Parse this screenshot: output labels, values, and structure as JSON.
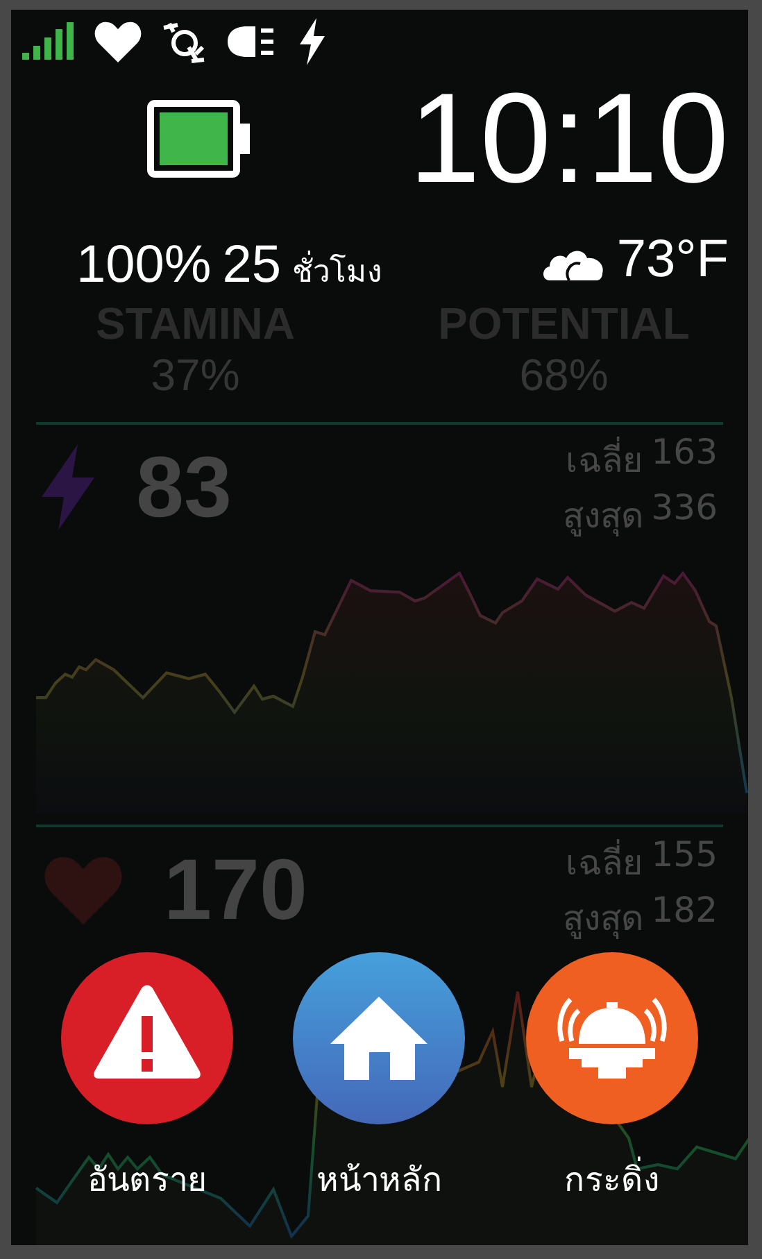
{
  "device_status": {
    "clock": "10:10",
    "battery_percent": "100%",
    "runtime": "25",
    "runtime_unit": "ชั่วโมง",
    "temperature": "73°F"
  },
  "metrics_header": [
    {
      "label": "STAMINA",
      "value": "37%"
    },
    {
      "label": "POTENTIAL",
      "value": "68%"
    }
  ],
  "fields": [
    {
      "kind": "power",
      "value": "83",
      "avg_label": "เฉลี่ย",
      "avg": "163",
      "max_label": "สูงสุด",
      "max": "336"
    },
    {
      "kind": "heart_rate",
      "value": "170",
      "avg_label": "เฉลี่ย",
      "avg": "155",
      "max_label": "สูงสุด",
      "max": "182"
    }
  ],
  "actions": [
    {
      "kind": "danger",
      "label": "อันตราย"
    },
    {
      "kind": "home",
      "label": "หน้าหลัก"
    },
    {
      "kind": "bell",
      "label": "กระดิ่ง"
    }
  ]
}
